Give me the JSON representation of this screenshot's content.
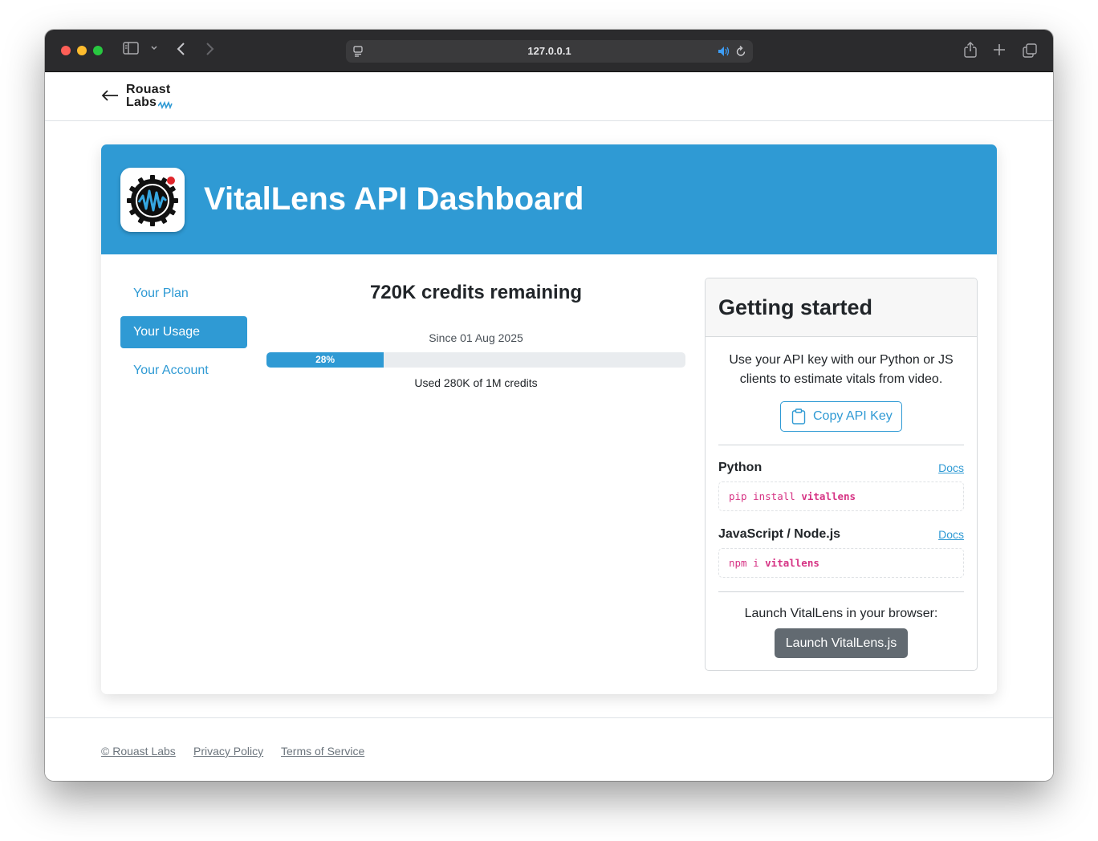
{
  "browser": {
    "url": "127.0.0.1",
    "icons": [
      "sidebar-icon",
      "chevron-down-icon",
      "back-icon",
      "forward-icon",
      "page-icon",
      "audio-icon",
      "reload-icon",
      "share-icon",
      "new-tab-icon",
      "tabs-icon"
    ]
  },
  "header": {
    "logo_line1": "Rouast",
    "logo_line2": "Labs",
    "back_icon": "arrow-left-icon"
  },
  "banner": {
    "title": "VitalLens API Dashboard",
    "color": "#2f9ad4"
  },
  "sidebar": {
    "items": [
      {
        "label": "Your Plan",
        "active": false
      },
      {
        "label": "Your Usage",
        "active": true
      },
      {
        "label": "Your Account",
        "active": false
      }
    ]
  },
  "usage": {
    "credits_remaining": "720K credits remaining",
    "since": "Since 01 Aug 2025",
    "progress_label": "28%",
    "progress_fraction": 0.28,
    "used": "Used 280K of 1M credits"
  },
  "getting_started": {
    "title": "Getting started",
    "description": "Use your API key with our Python or JS clients to estimate vitals from video.",
    "copy_button": "Copy API Key",
    "sections": [
      {
        "title": "Python",
        "docs": "Docs",
        "code_cmd": "pip install ",
        "code_pkg": "vitallens"
      },
      {
        "title": "JavaScript / Node.js",
        "docs": "Docs",
        "code_cmd": "npm i ",
        "code_pkg": "vitallens"
      }
    ],
    "launch_text": "Launch VitalLens in your browser:",
    "launch_button": "Launch VitalLens.js"
  },
  "footer": {
    "links": [
      "© Rouast Labs",
      "Privacy Policy",
      "Terms of Service"
    ]
  }
}
